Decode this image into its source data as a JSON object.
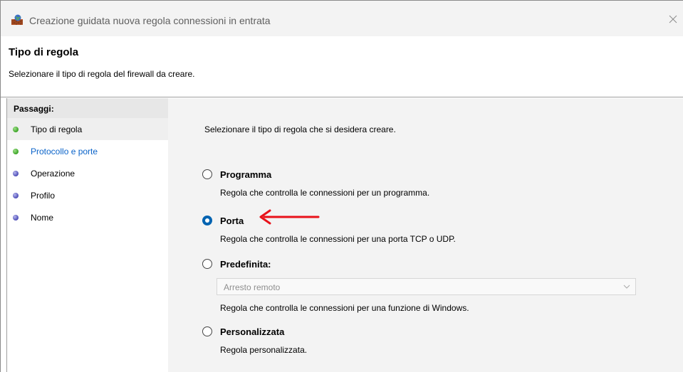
{
  "window": {
    "title": "Creazione guidata nuova regola connessioni in entrata"
  },
  "header": {
    "title": "Tipo di regola",
    "subtitle": "Selezionare il tipo di regola del firewall da creare."
  },
  "sidebar": {
    "heading": "Passaggi:",
    "steps": [
      {
        "label": "Tipo di regola",
        "status": "done",
        "active": true
      },
      {
        "label": "Protocollo e porte",
        "status": "done",
        "link": true
      },
      {
        "label": "Operazione",
        "status": "todo"
      },
      {
        "label": "Profilo",
        "status": "todo"
      },
      {
        "label": "Nome",
        "status": "todo"
      }
    ]
  },
  "main": {
    "intro": "Selezionare il tipo di regola che si desidera creare.",
    "options": [
      {
        "label": "Programma",
        "description": "Regola che controlla le connessioni per un programma.",
        "checked": false
      },
      {
        "label": "Porta",
        "description": "Regola che controlla le connessioni per una porta TCP o UDP.",
        "checked": true
      },
      {
        "label": "Predefinita:",
        "description": "Regola che controlla le connessioni per una funzione di Windows.",
        "checked": false
      },
      {
        "label": "Personalizzata",
        "description": "Regola personalizzata.",
        "checked": false
      }
    ],
    "predefined_dropdown": {
      "value": "Arresto remoto",
      "disabled": true
    }
  },
  "colors": {
    "accent": "#0063b1",
    "link": "#0a63c9",
    "annotation_arrow": "#e8121a",
    "step_done": "#3aa325",
    "step_todo": "#4c4cb6"
  },
  "icons": {
    "app": "firewall-bricks-icon",
    "close": "close-icon",
    "dropdown": "chevron-down-icon",
    "annotation": "red-arrow-icon"
  }
}
